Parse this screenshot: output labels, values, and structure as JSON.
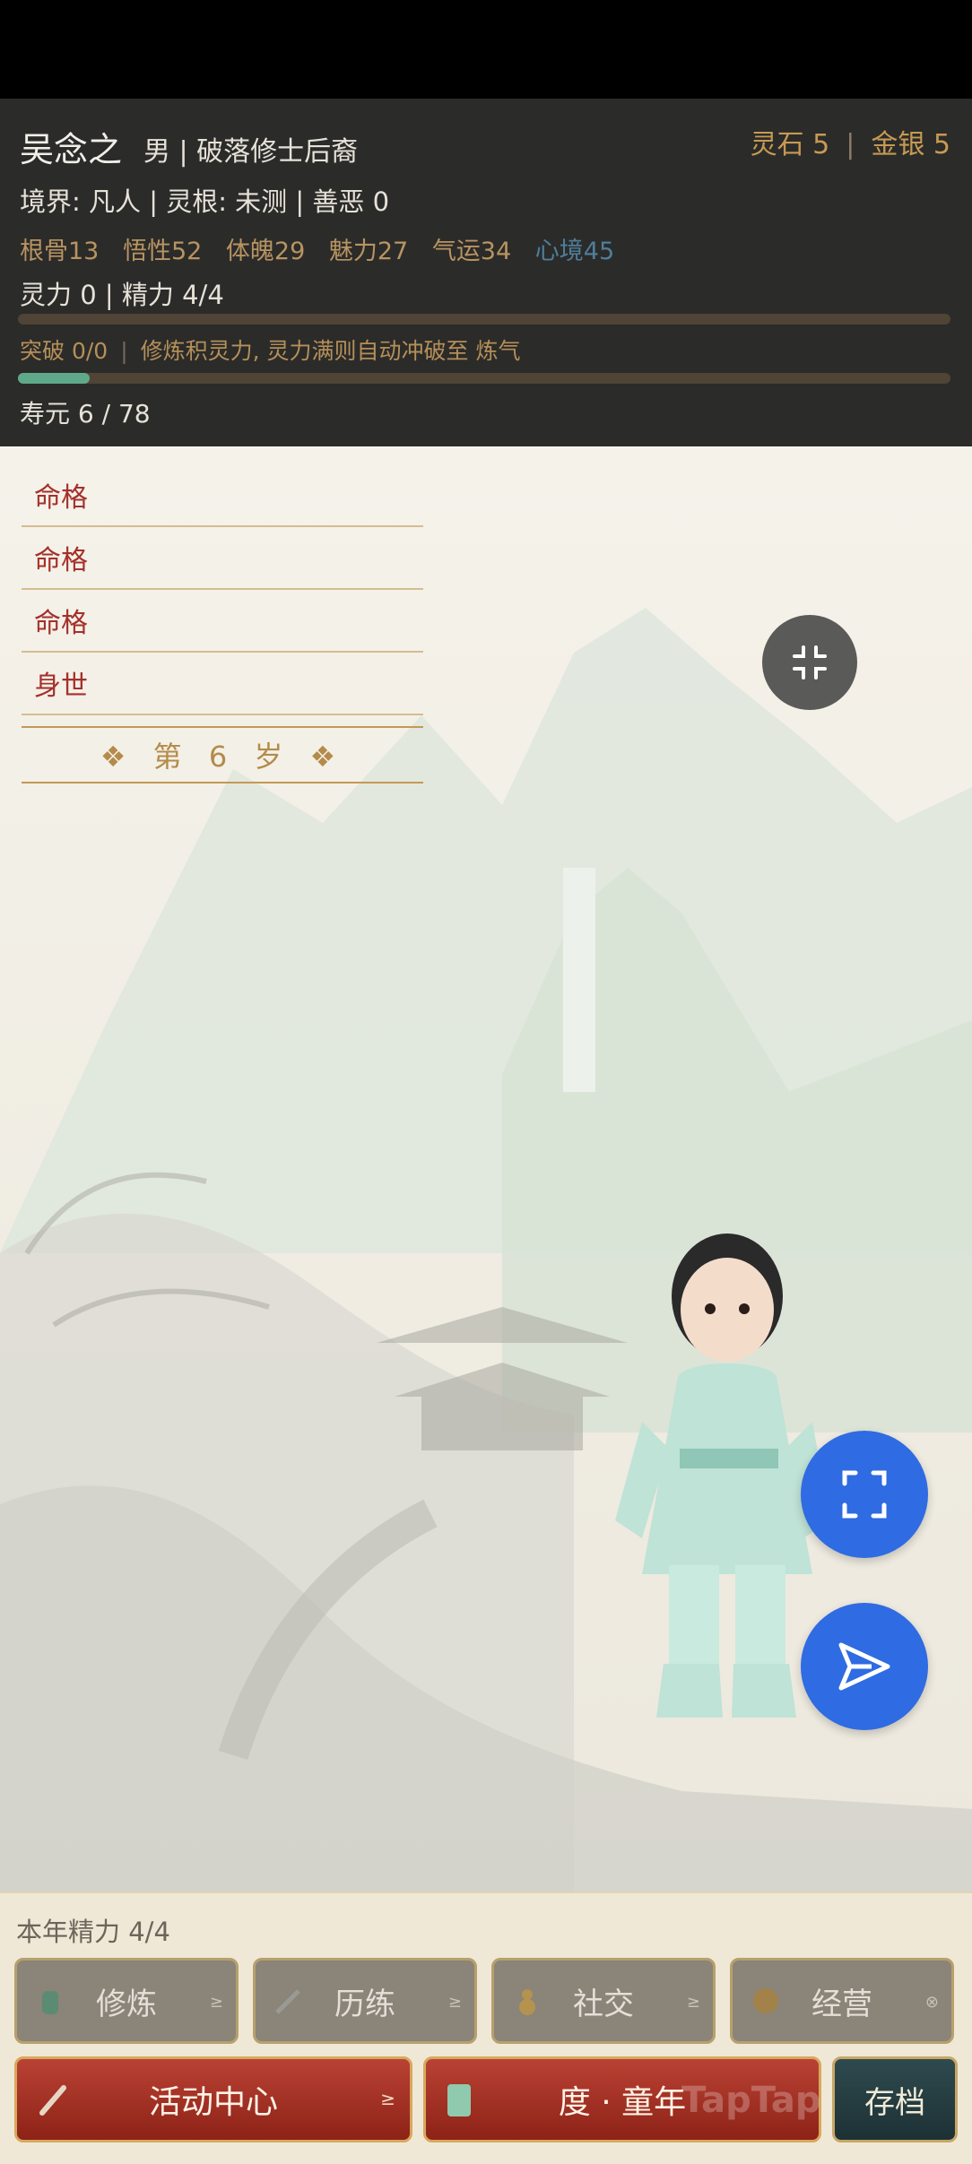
{
  "header": {
    "name": "吴念之",
    "sub": "男 | 破落修士后裔",
    "spirit_stone": "灵石 5",
    "gold": "金银 5",
    "realm_line": "境界: 凡人 | 灵根: 未测 | 善恶 0",
    "stats": [
      "根骨13",
      "悟性52",
      "体魄29",
      "魅力27",
      "气运34"
    ],
    "heart": "心境45",
    "power_line": "灵力 0 | 精力 4/4",
    "breakthrough": "突破 0/0",
    "breakthrough_hint": "修炼积灵力, 灵力满则自动冲破至 炼气",
    "breakthrough_progress": 0.0,
    "lifespan_progress": 0.077,
    "lifespan": "寿元 6 / 78",
    "colors": {
      "accent_gold": "#c79a52",
      "heart_blue": "#4f7e9a",
      "progress_green": "#5fa98a"
    }
  },
  "events": [
    "命格",
    "命格",
    "命格",
    "身世"
  ],
  "age_label": "❖ 第 6 岁 ❖",
  "icons": {
    "collapse": "collapse-icon",
    "fullscreen": "fullscreen-icon",
    "send": "send-icon"
  },
  "bottom": {
    "energy": "本年精力 4/4",
    "actions": [
      "修炼",
      "历练",
      "社交",
      "经营"
    ],
    "activity_center": "活动中心",
    "pass_year": "度 · 童年",
    "save": "存档",
    "watermark": "TapTap"
  }
}
